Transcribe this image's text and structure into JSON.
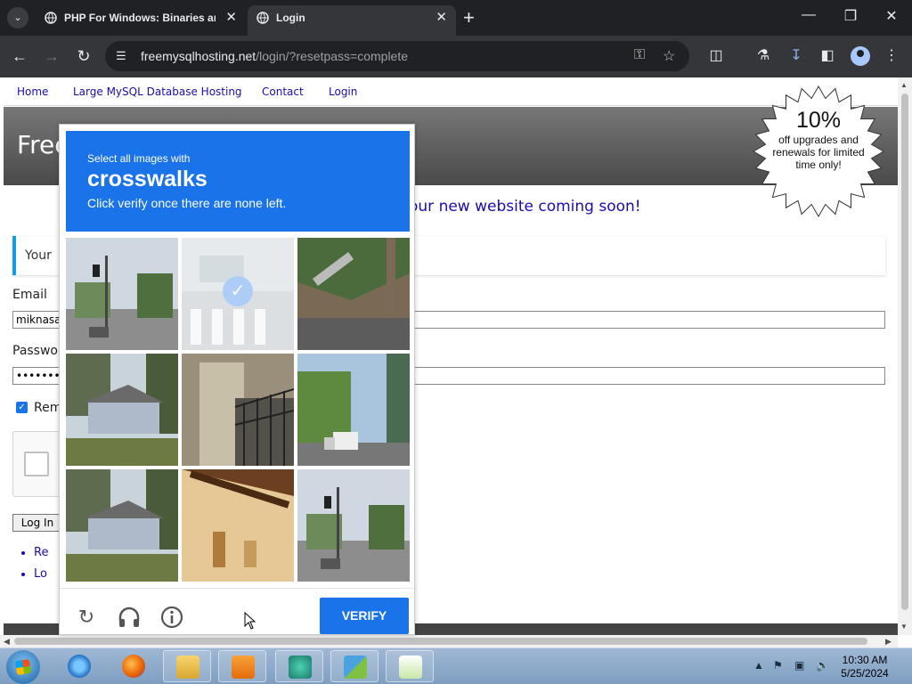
{
  "browser": {
    "tabs": [
      {
        "title": "PHP For Windows: Binaries and Sources Releases",
        "active": false
      },
      {
        "title": "Login",
        "active": true
      }
    ],
    "url_host": "freemysqlhosting.net",
    "url_path": "/login/?resetpass=complete"
  },
  "site": {
    "nav": [
      "Home",
      "Large MySQL Database Hosting",
      "Contact",
      "Login"
    ],
    "banner_title": "Free",
    "promo": {
      "percent": "10%",
      "text": "off upgrades and renewals for limited time only!"
    },
    "coming_soon": "our new website coming soon!",
    "notice": "Your",
    "email_label": "Email",
    "email_value": "miknasa",
    "password_label": "Passwo",
    "password_value": "•••••••••••",
    "remember_label": "Rem",
    "login_button": "Log In",
    "links": [
      "Re",
      "Lo"
    ]
  },
  "captcha": {
    "instruction": "Select all images with",
    "target": "crosswalks",
    "hint": "Click verify once there are none left.",
    "verify_label": "VERIFY",
    "tiles": [
      {
        "scene": "street-traffic-light",
        "selected": false
      },
      {
        "scene": "crosswalk",
        "selected": true
      },
      {
        "scene": "hillside-stairs",
        "selected": false
      },
      {
        "scene": "house-trees",
        "selected": false
      },
      {
        "scene": "balcony",
        "selected": false
      },
      {
        "scene": "street-truck",
        "selected": false
      },
      {
        "scene": "house-trees",
        "selected": false
      },
      {
        "scene": "roof-eave",
        "selected": false
      },
      {
        "scene": "street-traffic-light",
        "selected": false
      }
    ],
    "icons": [
      "reload-icon",
      "audio-icon",
      "info-icon"
    ]
  },
  "taskbar": {
    "apps": [
      "internet-explorer-icon",
      "firefox-icon",
      "file-explorer-icon",
      "media-player-icon",
      "browser-app-icon",
      "control-panel-icon",
      "notepad-icon"
    ],
    "time": "10:30 AM",
    "date": "5/25/2024"
  },
  "colors": {
    "accent": "#1a73e8",
    "chrome_dark": "#202124",
    "link": "#1a0dab"
  }
}
